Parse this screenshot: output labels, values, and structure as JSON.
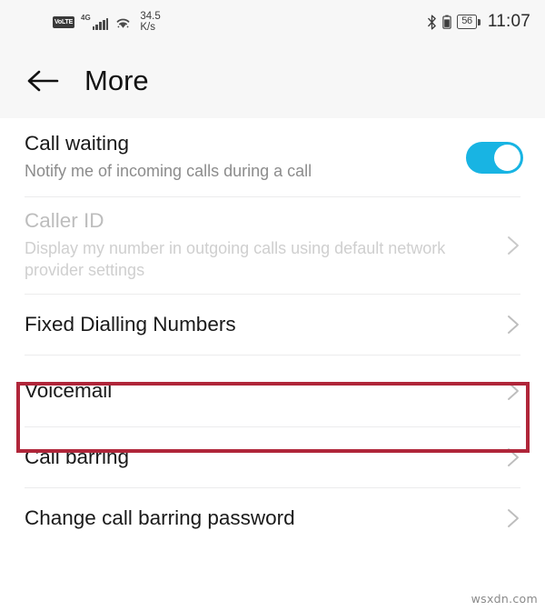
{
  "status_bar": {
    "volte_label": "VoLTE",
    "network_label": "4G",
    "signal_icon": "signal-bars-icon",
    "wifi_icon": "wifi-icon",
    "data_speed_value": "34.5",
    "data_speed_unit": "K/s",
    "bluetooth_icon": "bluetooth-icon",
    "battery_icon": "battery-icon",
    "battery_percent": "56",
    "time": "11:07"
  },
  "app_bar": {
    "back_icon": "arrow-left-icon",
    "title": "More"
  },
  "settings": {
    "rows": [
      {
        "key": "call_waiting",
        "title": "Call waiting",
        "subtitle": "Notify me of incoming calls during a call",
        "control": "toggle",
        "toggle_on": true,
        "disabled": false
      },
      {
        "key": "caller_id",
        "title": "Caller ID",
        "subtitle": "Display my number in outgoing calls using default network provider settings",
        "control": "chevron",
        "disabled": true
      },
      {
        "key": "fixed_dialling_numbers",
        "title": "Fixed Dialling Numbers",
        "subtitle": "",
        "control": "chevron",
        "disabled": false
      },
      {
        "key": "voicemail",
        "title": "Voicemail",
        "subtitle": "",
        "control": "chevron",
        "disabled": false,
        "highlighted": true
      },
      {
        "key": "call_barring",
        "title": "Call barring",
        "subtitle": "",
        "control": "chevron",
        "disabled": false
      },
      {
        "key": "change_call_barring_password",
        "title": "Change call barring password",
        "subtitle": "",
        "control": "chevron",
        "disabled": false
      }
    ]
  },
  "annotation": {
    "highlight_color": "#b0263a",
    "target": "Voicemail"
  },
  "colors": {
    "toggle_on": "#18b4e3",
    "header_bg": "#f7f7f7",
    "body_bg": "#ffffff",
    "divider": "#ececed",
    "title_text": "#1a1a1a",
    "sub_text": "#8c8c8c",
    "disabled_text": "#bdbdbd"
  },
  "watermark": {
    "text": "wsxdn.com"
  }
}
